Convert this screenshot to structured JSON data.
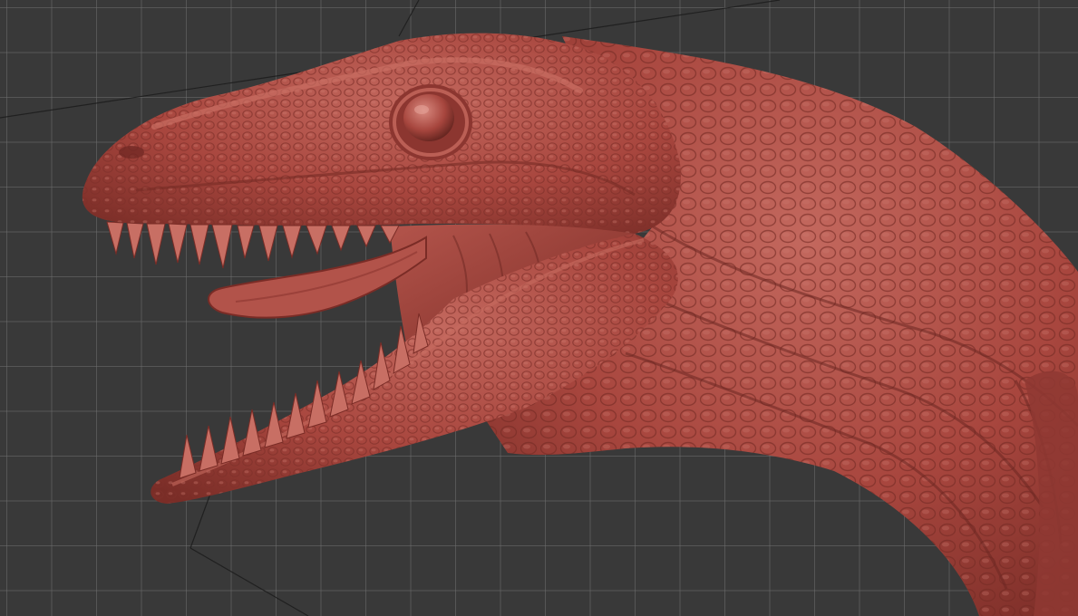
{
  "viewport": {
    "background_color": "#393939",
    "grid_color": "#6e6e6e",
    "mesh_color": "#a8443c",
    "mesh_highlight_color": "#c7685d",
    "mesh_shadow_color": "#6a2621",
    "subject": "sculpted-creature-head-mesh"
  }
}
